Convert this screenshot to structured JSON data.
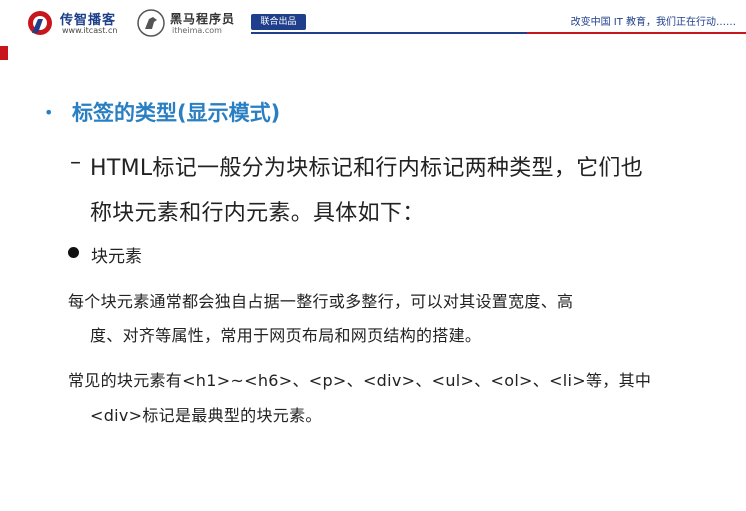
{
  "header": {
    "logo1_name": "传智播客",
    "logo1_url": "www.itcast.cn",
    "logo2_name": "黑马程序员",
    "logo2_url": "itheima.com",
    "joint_badge": "联合出品",
    "tagline": "改变中国 IT 教育，我们正在行动……",
    "colors": {
      "brand_blue": "#1f3f8c",
      "brand_red": "#c8161d",
      "title_blue": "#2a7fc2"
    }
  },
  "slide": {
    "title_bullet": "•",
    "title": "标签的类型(显示模式)",
    "dash": "–",
    "intro_line1": "HTML标记一般分为块标记和行内标记两种类型，它们也",
    "intro_line2": "称块元素和行内元素。具体如下：",
    "subhead": "块元素",
    "para1_line1": "每个块元素通常都会独自占据一整行或多整行，可以对其设置宽度、高",
    "para1_line2": "度、对齐等属性，常用于网页布局和网页结构的搭建。",
    "para2_line1": "常见的块元素有<h1>~<h6>、<p>、<div>、<ul>、<ol>、<li>等，其中",
    "para2_line2": "<div>标记是最典型的块元素。"
  }
}
